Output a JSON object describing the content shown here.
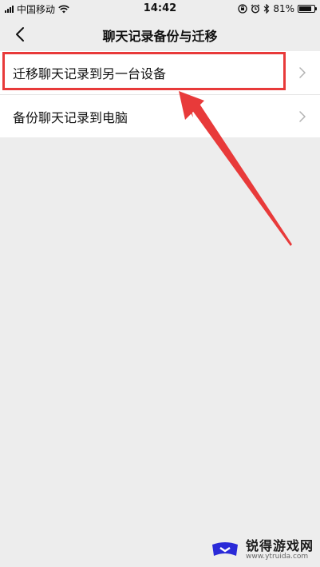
{
  "status_bar": {
    "carrier": "中国移动",
    "time": "14:42",
    "battery_percent": "81%",
    "battery_level": 0.81
  },
  "nav": {
    "title": "聊天记录备份与迁移"
  },
  "list": {
    "items": [
      {
        "label": "迁移聊天记录到另一台设备"
      },
      {
        "label": "备份聊天记录到电脑"
      }
    ]
  },
  "colors": {
    "background": "#ededed",
    "highlight": "#e83a3a"
  },
  "watermark": {
    "title": "锐得游戏网",
    "url": "www.ytruida.com"
  }
}
